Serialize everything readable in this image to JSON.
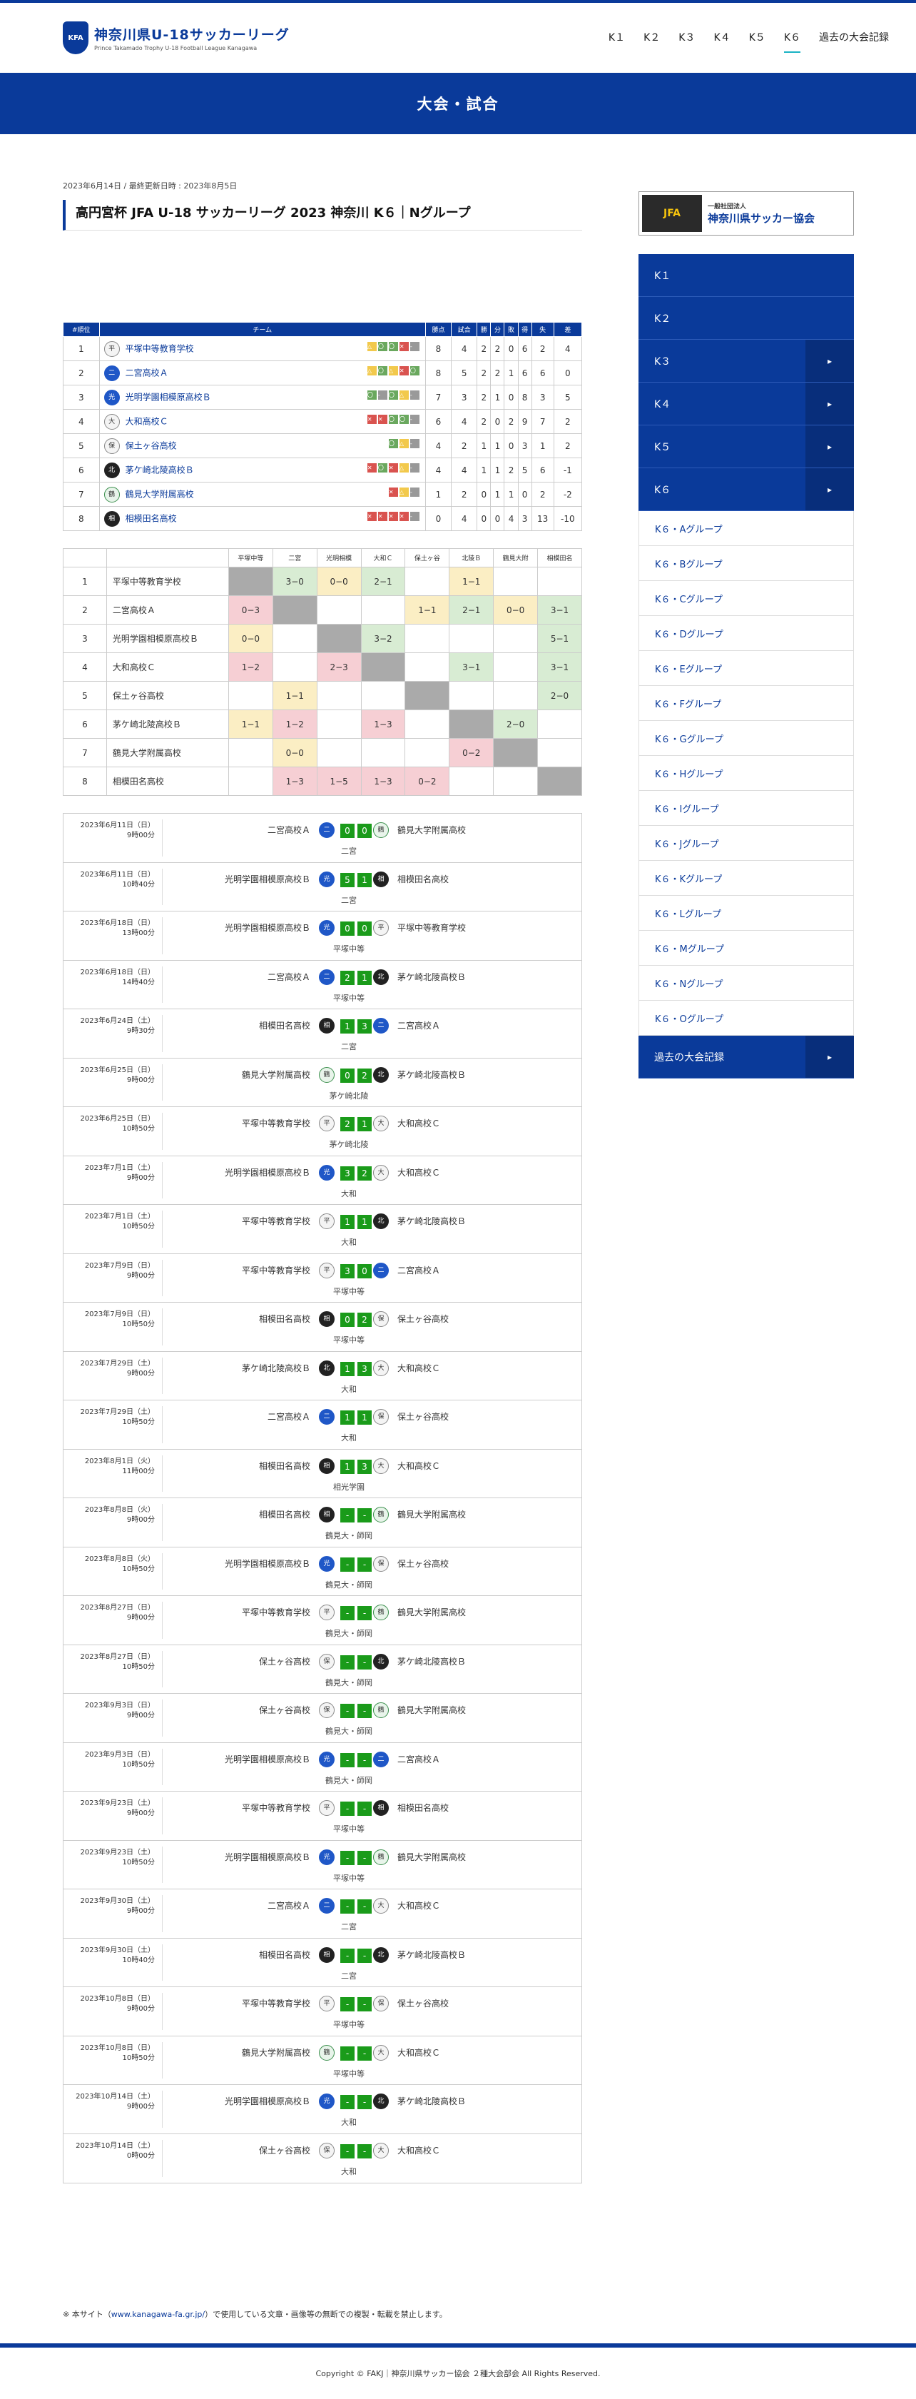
{
  "site": {
    "title": "神奈川県U-18サッカーリーグ",
    "subtitle": "Prince Takamado Trophy U-18 Football League Kanagawa",
    "badge": "KFA"
  },
  "nav": [
    {
      "label": "K１"
    },
    {
      "label": "K２"
    },
    {
      "label": "K３"
    },
    {
      "label": "K４"
    },
    {
      "label": "K５"
    },
    {
      "label": "K６",
      "active": true
    },
    {
      "label": "過去の大会記録"
    }
  ],
  "banner": "大会・試合",
  "meta": "2023年6月14日 / 最終更新日時 : 2023年8月5日",
  "page_title": "高円宮杯 JFA U-18 サッカーリーグ 2023 神奈川 K６｜Nグループ",
  "standings_headers": [
    "#順位",
    "チーム",
    "勝点",
    "試合",
    "勝",
    "分",
    "敗",
    "得",
    "失",
    "差"
  ],
  "standings": [
    {
      "rank": "1",
      "team": "平塚中等教育学校",
      "icon": "平",
      "form": [
        "d",
        "w",
        "w",
        "l",
        "g"
      ],
      "pts": "8",
      "p": "4",
      "w": "2",
      "d": "2",
      "l": "0",
      "gf": "6",
      "ga": "2",
      "gd": "4"
    },
    {
      "rank": "2",
      "team": "二宮高校Ａ",
      "icon": "二",
      "form": [
        "d",
        "w",
        "d",
        "l",
        "w"
      ],
      "pts": "8",
      "p": "5",
      "w": "2",
      "d": "2",
      "l": "1",
      "gf": "6",
      "ga": "6",
      "gd": "0"
    },
    {
      "rank": "3",
      "team": "光明学園相模原高校Ｂ",
      "icon": "光",
      "form": [
        "w",
        "g",
        "w",
        "d",
        "g"
      ],
      "pts": "7",
      "p": "3",
      "w": "2",
      "d": "1",
      "l": "0",
      "gf": "8",
      "ga": "3",
      "gd": "5"
    },
    {
      "rank": "4",
      "team": "大和高校Ｃ",
      "icon": "大",
      "form": [
        "l",
        "l",
        "w",
        "w",
        "g"
      ],
      "pts": "6",
      "p": "4",
      "w": "2",
      "d": "0",
      "l": "2",
      "gf": "9",
      "ga": "7",
      "gd": "2"
    },
    {
      "rank": "5",
      "team": "保土ヶ谷高校",
      "icon": "保",
      "form": [
        "w",
        "d",
        "g"
      ],
      "pts": "4",
      "p": "2",
      "w": "1",
      "d": "1",
      "l": "0",
      "gf": "3",
      "ga": "1",
      "gd": "2"
    },
    {
      "rank": "6",
      "team": "茅ケ崎北陵高校Ｂ",
      "icon": "北",
      "form": [
        "l",
        "w",
        "l",
        "d",
        "g"
      ],
      "pts": "4",
      "p": "4",
      "w": "1",
      "d": "1",
      "l": "2",
      "gf": "5",
      "ga": "6",
      "gd": "-1"
    },
    {
      "rank": "7",
      "team": "鶴見大学附属高校",
      "icon": "鶴",
      "form": [
        "l",
        "d",
        "g"
      ],
      "pts": "1",
      "p": "2",
      "w": "0",
      "d": "1",
      "l": "1",
      "gf": "0",
      "ga": "2",
      "gd": "-2"
    },
    {
      "rank": "8",
      "team": "相模田名高校",
      "icon": "相",
      "form": [
        "l",
        "l",
        "l",
        "l",
        "g"
      ],
      "pts": "0",
      "p": "4",
      "w": "0",
      "d": "0",
      "l": "4",
      "gf": "3",
      "ga": "13",
      "gd": "-10"
    }
  ],
  "grid_headers": [
    "平塚中等",
    "二宮",
    "光明相模",
    "大和Ｃ",
    "保土ヶ谷",
    "北陵Ｂ",
    "鶴見大附",
    "相模田名"
  ],
  "grid": [
    {
      "rank": "1",
      "team": "平塚中等教育学校",
      "cells": [
        [
          "",
          "g"
        ],
        [
          "3−0",
          "w"
        ],
        [
          "0−0",
          "d"
        ],
        [
          "2−1",
          "w"
        ],
        [
          "",
          ""
        ],
        [
          "1−1",
          "d"
        ],
        [
          "",
          ""
        ],
        [
          "",
          ""
        ]
      ]
    },
    {
      "rank": "2",
      "team": "二宮高校Ａ",
      "cells": [
        [
          "0−3",
          "l"
        ],
        [
          "",
          "g"
        ],
        [
          "",
          ""
        ],
        [
          "",
          ""
        ],
        [
          "1−1",
          "d"
        ],
        [
          "2−1",
          "w"
        ],
        [
          "0−0",
          "d"
        ],
        [
          "3−1",
          "w"
        ]
      ]
    },
    {
      "rank": "3",
      "team": "光明学園相模原高校Ｂ",
      "cells": [
        [
          "0−0",
          "d"
        ],
        [
          "",
          ""
        ],
        [
          "",
          "g"
        ],
        [
          "3−2",
          "w"
        ],
        [
          "",
          ""
        ],
        [
          "",
          ""
        ],
        [
          "",
          ""
        ],
        [
          "5−1",
          "w"
        ]
      ]
    },
    {
      "rank": "4",
      "team": "大和高校Ｃ",
      "cells": [
        [
          "1−2",
          "l"
        ],
        [
          "",
          ""
        ],
        [
          "2−3",
          "l"
        ],
        [
          "",
          "g"
        ],
        [
          "",
          ""
        ],
        [
          "3−1",
          "w"
        ],
        [
          "",
          ""
        ],
        [
          "3−1",
          "w"
        ]
      ]
    },
    {
      "rank": "5",
      "team": "保土ヶ谷高校",
      "cells": [
        [
          "",
          ""
        ],
        [
          "1−1",
          "d"
        ],
        [
          "",
          ""
        ],
        [
          "",
          ""
        ],
        [
          "",
          "g"
        ],
        [
          "",
          ""
        ],
        [
          "",
          ""
        ],
        [
          "2−0",
          "w"
        ]
      ]
    },
    {
      "rank": "6",
      "team": "茅ケ崎北陵高校Ｂ",
      "cells": [
        [
          "1−1",
          "d"
        ],
        [
          "1−2",
          "l"
        ],
        [
          "",
          ""
        ],
        [
          "1−3",
          "l"
        ],
        [
          "",
          ""
        ],
        [
          "",
          "g"
        ],
        [
          "2−0",
          "w"
        ],
        [
          "",
          ""
        ]
      ]
    },
    {
      "rank": "7",
      "team": "鶴見大学附属高校",
      "cells": [
        [
          "",
          ""
        ],
        [
          "0−0",
          "d"
        ],
        [
          "",
          ""
        ],
        [
          "",
          ""
        ],
        [
          "",
          ""
        ],
        [
          "0−2",
          "l"
        ],
        [
          "",
          "g"
        ],
        [
          "",
          ""
        ]
      ]
    },
    {
      "rank": "8",
      "team": "相模田名高校",
      "cells": [
        [
          "",
          ""
        ],
        [
          "1−3",
          "l"
        ],
        [
          "1−5",
          "l"
        ],
        [
          "1−3",
          "l"
        ],
        [
          "0−2",
          "l"
        ],
        [
          "",
          ""
        ],
        [
          "",
          ""
        ],
        [
          "",
          "g"
        ]
      ]
    }
  ],
  "matches": [
    {
      "date": "2023年6月11日（日）",
      "time": "9時00分",
      "home": "二宮高校Ａ",
      "hi": "二",
      "hs": "0",
      "as": "0",
      "away": "鶴見大学附属高校",
      "ai": "鶴",
      "venue": "二宮"
    },
    {
      "date": "2023年6月11日（日）",
      "time": "10時40分",
      "home": "光明学園相模原高校Ｂ",
      "hi": "光",
      "hs": "5",
      "as": "1",
      "away": "相模田名高校",
      "ai": "相",
      "venue": "二宮"
    },
    {
      "date": "2023年6月18日（日）",
      "time": "13時00分",
      "home": "光明学園相模原高校Ｂ",
      "hi": "光",
      "hs": "0",
      "as": "0",
      "away": "平塚中等教育学校",
      "ai": "平",
      "venue": "平塚中等"
    },
    {
      "date": "2023年6月18日（日）",
      "time": "14時40分",
      "home": "二宮高校Ａ",
      "hi": "二",
      "hs": "2",
      "as": "1",
      "away": "茅ケ崎北陵高校Ｂ",
      "ai": "北",
      "venue": "平塚中等"
    },
    {
      "date": "2023年6月24日（土）",
      "time": "9時30分",
      "home": "相模田名高校",
      "hi": "相",
      "hs": "1",
      "as": "3",
      "away": "二宮高校Ａ",
      "ai": "二",
      "venue": "二宮"
    },
    {
      "date": "2023年6月25日（日）",
      "time": "9時00分",
      "home": "鶴見大学附属高校",
      "hi": "鶴",
      "hs": "0",
      "as": "2",
      "away": "茅ケ崎北陵高校Ｂ",
      "ai": "北",
      "venue": "茅ケ崎北陵"
    },
    {
      "date": "2023年6月25日（日）",
      "time": "10時50分",
      "home": "平塚中等教育学校",
      "hi": "平",
      "hs": "2",
      "as": "1",
      "away": "大和高校Ｃ",
      "ai": "大",
      "venue": "茅ケ崎北陵"
    },
    {
      "date": "2023年7月1日（土）",
      "time": "9時00分",
      "home": "光明学園相模原高校Ｂ",
      "hi": "光",
      "hs": "3",
      "as": "2",
      "away": "大和高校Ｃ",
      "ai": "大",
      "venue": "大和"
    },
    {
      "date": "2023年7月1日（土）",
      "time": "10時50分",
      "home": "平塚中等教育学校",
      "hi": "平",
      "hs": "1",
      "as": "1",
      "away": "茅ケ崎北陵高校Ｂ",
      "ai": "北",
      "venue": "大和"
    },
    {
      "date": "2023年7月9日（日）",
      "time": "9時00分",
      "home": "平塚中等教育学校",
      "hi": "平",
      "hs": "3",
      "as": "0",
      "away": "二宮高校Ａ",
      "ai": "二",
      "venue": "平塚中等"
    },
    {
      "date": "2023年7月9日（日）",
      "time": "10時50分",
      "home": "相模田名高校",
      "hi": "相",
      "hs": "0",
      "as": "2",
      "away": "保土ヶ谷高校",
      "ai": "保",
      "venue": "平塚中等"
    },
    {
      "date": "2023年7月29日（土）",
      "time": "9時00分",
      "home": "茅ケ崎北陵高校Ｂ",
      "hi": "北",
      "hs": "1",
      "as": "3",
      "away": "大和高校Ｃ",
      "ai": "大",
      "venue": "大和"
    },
    {
      "date": "2023年7月29日（土）",
      "time": "10時50分",
      "home": "二宮高校Ａ",
      "hi": "二",
      "hs": "1",
      "as": "1",
      "away": "保土ヶ谷高校",
      "ai": "保",
      "venue": "大和"
    },
    {
      "date": "2023年8月1日（火）",
      "time": "11時00分",
      "home": "相模田名高校",
      "hi": "相",
      "hs": "1",
      "as": "3",
      "away": "大和高校Ｃ",
      "ai": "大",
      "venue": "相光学園"
    },
    {
      "date": "2023年8月8日（火）",
      "time": "9時00分",
      "home": "相模田名高校",
      "hi": "相",
      "hs": "-",
      "as": "-",
      "away": "鶴見大学附属高校",
      "ai": "鶴",
      "venue": "鶴見大・師岡"
    },
    {
      "date": "2023年8月8日（火）",
      "time": "10時50分",
      "home": "光明学園相模原高校Ｂ",
      "hi": "光",
      "hs": "-",
      "as": "-",
      "away": "保土ヶ谷高校",
      "ai": "保",
      "venue": "鶴見大・師岡"
    },
    {
      "date": "2023年8月27日（日）",
      "time": "9時00分",
      "home": "平塚中等教育学校",
      "hi": "平",
      "hs": "-",
      "as": "-",
      "away": "鶴見大学附属高校",
      "ai": "鶴",
      "venue": "鶴見大・師岡"
    },
    {
      "date": "2023年8月27日（日）",
      "time": "10時50分",
      "home": "保土ヶ谷高校",
      "hi": "保",
      "hs": "-",
      "as": "-",
      "away": "茅ケ崎北陵高校Ｂ",
      "ai": "北",
      "venue": "鶴見大・師岡"
    },
    {
      "date": "2023年9月3日（日）",
      "time": "9時00分",
      "home": "保土ヶ谷高校",
      "hi": "保",
      "hs": "-",
      "as": "-",
      "away": "鶴見大学附属高校",
      "ai": "鶴",
      "venue": "鶴見大・師岡"
    },
    {
      "date": "2023年9月3日（日）",
      "time": "10時50分",
      "home": "光明学園相模原高校Ｂ",
      "hi": "光",
      "hs": "-",
      "as": "-",
      "away": "二宮高校Ａ",
      "ai": "二",
      "venue": "鶴見大・師岡"
    },
    {
      "date": "2023年9月23日（土）",
      "time": "9時00分",
      "home": "平塚中等教育学校",
      "hi": "平",
      "hs": "-",
      "as": "-",
      "away": "相模田名高校",
      "ai": "相",
      "venue": "平塚中等"
    },
    {
      "date": "2023年9月23日（土）",
      "time": "10時50分",
      "home": "光明学園相模原高校Ｂ",
      "hi": "光",
      "hs": "-",
      "as": "-",
      "away": "鶴見大学附属高校",
      "ai": "鶴",
      "venue": "平塚中等"
    },
    {
      "date": "2023年9月30日（土）",
      "time": "9時00分",
      "home": "二宮高校Ａ",
      "hi": "二",
      "hs": "-",
      "as": "-",
      "away": "大和高校Ｃ",
      "ai": "大",
      "venue": "二宮"
    },
    {
      "date": "2023年9月30日（土）",
      "time": "10時40分",
      "home": "相模田名高校",
      "hi": "相",
      "hs": "-",
      "as": "-",
      "away": "茅ケ崎北陵高校Ｂ",
      "ai": "北",
      "venue": "二宮"
    },
    {
      "date": "2023年10月8日（日）",
      "time": "9時00分",
      "home": "平塚中等教育学校",
      "hi": "平",
      "hs": "-",
      "as": "-",
      "away": "保土ヶ谷高校",
      "ai": "保",
      "venue": "平塚中等"
    },
    {
      "date": "2023年10月8日（日）",
      "time": "10時50分",
      "home": "鶴見大学附属高校",
      "hi": "鶴",
      "hs": "-",
      "as": "-",
      "away": "大和高校Ｃ",
      "ai": "大",
      "venue": "平塚中等"
    },
    {
      "date": "2023年10月14日（土）",
      "time": "9時00分",
      "home": "光明学園相模原高校Ｂ",
      "hi": "光",
      "hs": "-",
      "as": "-",
      "away": "茅ケ崎北陵高校Ｂ",
      "ai": "北",
      "venue": "大和"
    },
    {
      "date": "2023年10月14日（土）",
      "time": "0時00分",
      "home": "保土ヶ谷高校",
      "hi": "保",
      "hs": "-",
      "as": "-",
      "away": "大和高校Ｃ",
      "ai": "大",
      "venue": "大和"
    }
  ],
  "sidebar": {
    "jfa": "JFA",
    "assoc": "神奈川県サッカー協会",
    "assoc_sub": "一般社団法人",
    "menu": [
      {
        "label": "K１",
        "arrow": false
      },
      {
        "label": "K２",
        "arrow": false
      },
      {
        "label": "K３",
        "arrow": true
      },
      {
        "label": "K４",
        "arrow": true
      },
      {
        "label": "K５",
        "arrow": true
      },
      {
        "label": "K６",
        "arrow": true
      }
    ],
    "arrow_glyph": "▸",
    "groups": [
      "K６・Aグループ",
      "K６・Bグループ",
      "K６・Cグループ",
      "K６・Dグループ",
      "K６・Eグループ",
      "K６・Fグループ",
      "K６・Gグループ",
      "K６・Hグループ",
      "K６・Iグループ",
      "K６・Jグループ",
      "K６・Kグループ",
      "K６・Lグループ",
      "K６・Mグループ",
      "K６・Nグループ",
      "K６・Oグループ"
    ],
    "past": "過去の大会記録"
  },
  "footnote_pre": "※ 本サイト（",
  "footnote_link": "www.kanagawa-fa.gr.jp/",
  "footnote_post": "）で使用している文章・画像等の無断での複製・転載を禁止します。",
  "copyright": "Copyright © FAKJ｜神奈川県サッカー協会 ２種大会部会 All Rights Reserved."
}
